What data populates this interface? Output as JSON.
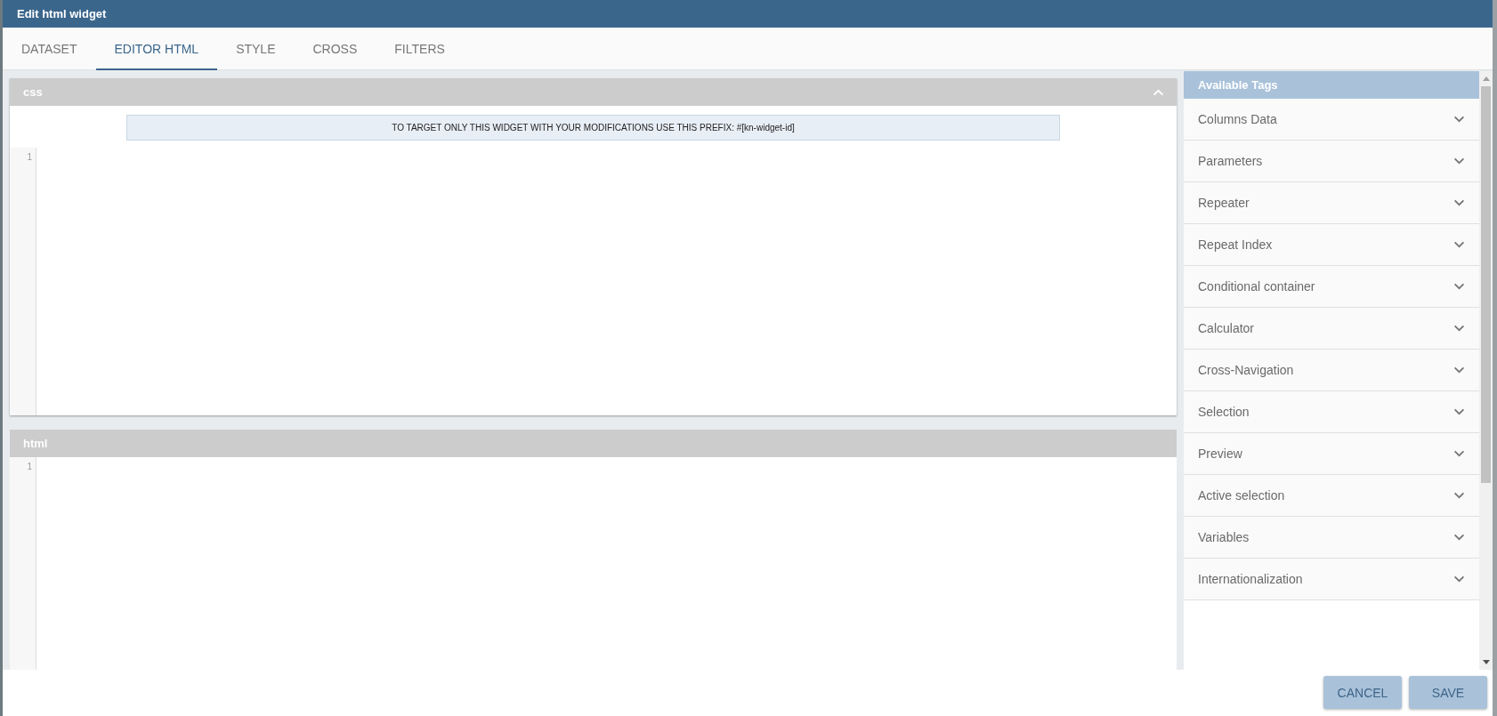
{
  "window": {
    "title": "Edit html widget"
  },
  "tabs": [
    {
      "label": "DATASET",
      "selected": false
    },
    {
      "label": "EDITOR HTML",
      "selected": true
    },
    {
      "label": "STYLE",
      "selected": false
    },
    {
      "label": "CROSS",
      "selected": false
    },
    {
      "label": "FILTERS",
      "selected": false
    }
  ],
  "editors": [
    {
      "title": "css",
      "collapsible": true,
      "notice": "TO TARGET ONLY THIS WIDGET WITH YOUR MODIFICATIONS USE THIS PREFIX: #[kn-widget-id]",
      "line_numbers": [
        "1"
      ]
    },
    {
      "title": "html",
      "collapsible": false,
      "line_numbers": [
        "1"
      ]
    }
  ],
  "available_tags": {
    "title": "Available Tags",
    "items": [
      {
        "label": "Columns Data",
        "expanded": false
      },
      {
        "label": "Parameters",
        "expanded": false
      },
      {
        "label": "Repeater",
        "expanded": false
      },
      {
        "label": "Repeat Index",
        "expanded": false
      },
      {
        "label": "Conditional container",
        "expanded": false
      },
      {
        "label": "Calculator",
        "expanded": false
      },
      {
        "label": "Cross-Navigation",
        "expanded": false
      },
      {
        "label": "Selection",
        "expanded": false
      },
      {
        "label": "Preview",
        "expanded": false
      },
      {
        "label": "Active selection",
        "expanded": false
      },
      {
        "label": "Variables",
        "expanded": false
      },
      {
        "label": "Internationalization",
        "expanded": false
      }
    ]
  },
  "buttons": [
    {
      "label": "CANCEL"
    },
    {
      "label": "SAVE"
    }
  ]
}
